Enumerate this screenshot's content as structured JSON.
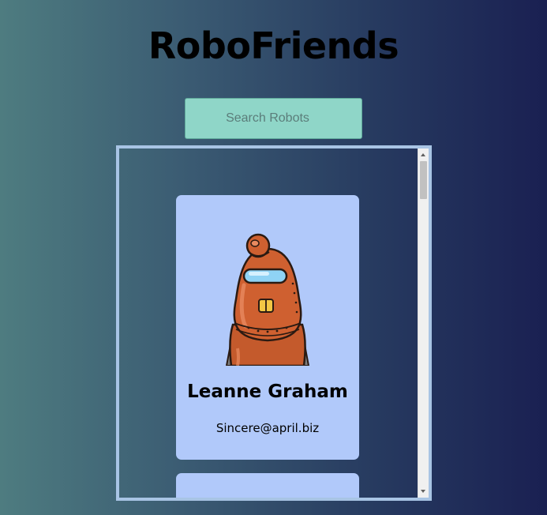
{
  "header": {
    "title": "RoboFriends"
  },
  "search": {
    "placeholder": "Search Robots",
    "value": ""
  },
  "robots": [
    {
      "name": "Leanne Graham",
      "email": "Sincere@april.biz",
      "image_icon": "robot-avatar"
    },
    {
      "name": "",
      "email": "",
      "image_icon": "robot-avatar"
    }
  ],
  "colors": {
    "card_background": "#b1c9fa",
    "search_background": "#8fd6c8",
    "scroll_border": "#a8c4e4"
  }
}
